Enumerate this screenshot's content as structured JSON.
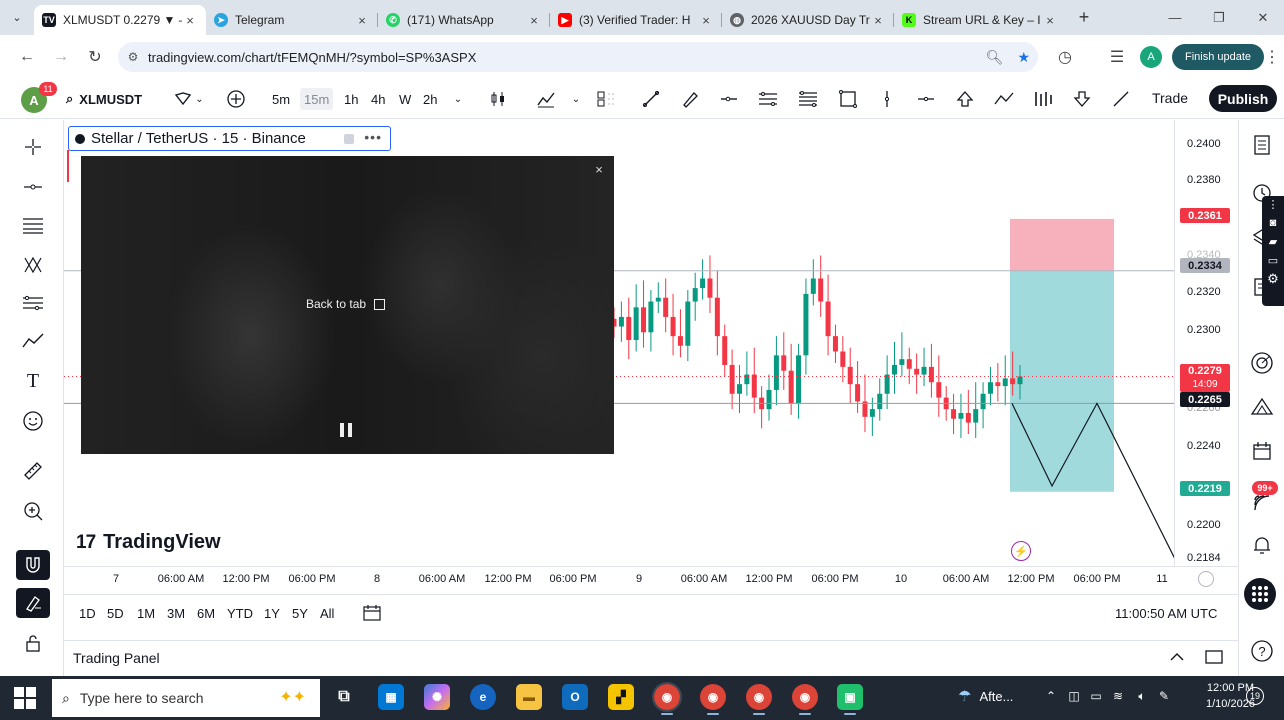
{
  "browser": {
    "tabs": [
      {
        "title": "XLMUSDT 0.2279 ▼ –",
        "favicon": "tradingview-favicon",
        "active": true
      },
      {
        "title": "Telegram",
        "favicon": "telegram-favicon",
        "active": false
      },
      {
        "title": "(171) WhatsApp",
        "favicon": "whatsapp-favicon",
        "active": false
      },
      {
        "title": "(3) Verified Trader: H",
        "favicon": "youtube-favicon",
        "active": false
      },
      {
        "title": "2026 XAUUSD Day Tr",
        "favicon": "globe-favicon",
        "active": false
      },
      {
        "title": "Stream URL & Key – I",
        "favicon": "kick-favicon",
        "active": false
      }
    ],
    "url": "tradingview.com/chart/tFEMQnMH/?symbol=SP%3ASPX",
    "profile_initial": "A",
    "finish_update_label": "Finish update"
  },
  "tv_toolbar": {
    "user_initial": "A",
    "notification_count": "11",
    "symbol": "XLMUSDT",
    "intervals": [
      "5m",
      "15m",
      "1h",
      "4h",
      "W",
      "2h"
    ],
    "selected_interval": "15m",
    "trade_label": "Trade",
    "publish_label": "Publish"
  },
  "legend": {
    "title": "Stellar / TetherUS · 15 · Binance"
  },
  "pip": {
    "back_to_tab_label": "Back to tab",
    "close_label": "×"
  },
  "watermark": "TradingView",
  "price_scale": {
    "ticks": [
      "0.2400",
      "0.2380",
      "0.2340",
      "0.2320",
      "0.2300",
      "0.2260",
      "0.2240",
      "0.2200",
      "0.2184"
    ],
    "tags": {
      "stop": "0.2361",
      "entry": "0.2334",
      "current": "0.2279",
      "countdown": "14:09",
      "level": "0.2265",
      "target": "0.2219"
    },
    "colors": {
      "stop": "#f23645",
      "entry": "#b2b5be",
      "current": "#f23645",
      "level": "#131722",
      "target": "#22ab94"
    }
  },
  "time_axis": {
    "ticks": [
      "7",
      "06:00 AM",
      "12:00 PM",
      "06:00 PM",
      "8",
      "06:00 AM",
      "12:00 PM",
      "06:00 PM",
      "9",
      "06:00 AM",
      "12:00 PM",
      "06:00 PM",
      "10",
      "06:00 AM",
      "12:00 PM",
      "06:00 PM",
      "11"
    ]
  },
  "range_bar": {
    "ranges": [
      "1D",
      "5D",
      "1M",
      "3M",
      "6M",
      "YTD",
      "1Y",
      "5Y",
      "All"
    ],
    "clock": "11:00:50 AM UTC"
  },
  "trading_panel_label": "Trading Panel",
  "right_panel": {
    "badge": "99+"
  },
  "taskbar": {
    "search_placeholder": "Type here to search",
    "weather": "Afte...",
    "time": "12:00 PM",
    "date": "1/10/2026",
    "notification_count": "19"
  },
  "chart_data": {
    "type": "candlestick",
    "symbol": "XLMUSDT",
    "interval": "15m",
    "x_range": [
      "7",
      "11"
    ],
    "y_range": [
      0.2184,
      0.24
    ],
    "close_series": [
      0.2305,
      0.231,
      0.2298,
      0.2315,
      0.2302,
      0.2318,
      0.232,
      0.231,
      0.23,
      0.2295,
      0.2318,
      0.2325,
      0.233,
      0.232,
      0.23,
      0.2285,
      0.227,
      0.2275,
      0.228,
      0.2268,
      0.2262,
      0.2272,
      0.229,
      0.2282,
      0.2265,
      0.229,
      0.2322,
      0.233,
      0.2318,
      0.23,
      0.2292,
      0.2284,
      0.2275,
      0.2266,
      0.2258,
      0.2262,
      0.227,
      0.228,
      0.2285,
      0.2288,
      0.2283,
      0.228,
      0.2284,
      0.2276,
      0.2268,
      0.2262,
      0.2257,
      0.226,
      0.2255,
      0.2262,
      0.227,
      0.2276,
      0.2274,
      0.2278,
      0.2275,
      0.2279
    ],
    "position": {
      "entry": 0.2334,
      "stop": 0.2361,
      "target": 0.2219
    },
    "horizontal_lines": [
      0.2334,
      0.2265
    ]
  }
}
